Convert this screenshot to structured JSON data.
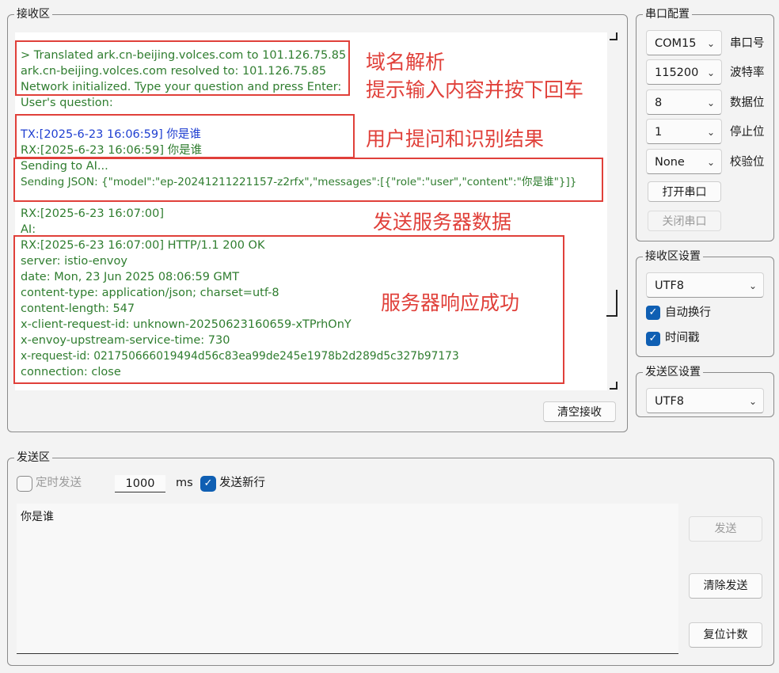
{
  "receive": {
    "title": "接收区",
    "lines": [
      "> Translated ark.cn-beijing.volces.com to 101.126.75.85",
      "ark.cn-beijing.volces.com resolved to: 101.126.75.85",
      "Network initialized. Type your question and press Enter:",
      "User's question:",
      "TX:[2025-6-23 16:06:59] 你是谁",
      "RX:[2025-6-23 16:06:59] 你是谁",
      "Sending to AI...",
      "Sending JSON: {\"model\":\"ep-20241211221157-z2rfx\",\"messages\":[{\"role\":\"user\",\"content\":\"你是谁\"}]}",
      "RX:[2025-6-23 16:07:00]",
      "AI:",
      "RX:[2025-6-23 16:07:00] HTTP/1.1 200 OK",
      "server: istio-envoy",
      "date: Mon, 23 Jun 2025 08:06:59 GMT",
      "content-type: application/json; charset=utf-8",
      "content-length: 547",
      "x-client-request-id: unknown-20250623160659-xTPrhOnY",
      "x-envoy-upstream-service-time: 730",
      "x-request-id: 021750666019494d56c83ea99de245e1978b2d289d5c327b97173",
      "connection: close"
    ],
    "annotations": [
      "域名解析",
      "提示输入内容并按下回车",
      "用户提问和识别结果",
      "发送服务器数据",
      "服务器响应成功"
    ],
    "clear_button": "清空接收"
  },
  "serial": {
    "title": "串口配置",
    "port": {
      "value": "COM15",
      "label": "串口号"
    },
    "baud": {
      "value": "115200",
      "label": "波特率"
    },
    "data_bits": {
      "value": "8",
      "label": "数据位"
    },
    "stop_bits": {
      "value": "1",
      "label": "停止位"
    },
    "parity": {
      "value": "None",
      "label": "校验位"
    },
    "open_button": "打开串口",
    "close_button": "关闭串口"
  },
  "recv_settings": {
    "title": "接收区设置",
    "encoding": "UTF8",
    "auto_wrap": {
      "label": "自动换行",
      "checked": true
    },
    "timestamp": {
      "label": "时间戳",
      "checked": true
    }
  },
  "send_settings": {
    "title": "发送区设置",
    "encoding": "UTF8"
  },
  "send": {
    "title": "发送区",
    "timed_send_label": "定时发送",
    "interval": "1000",
    "unit": "ms",
    "newline_label": "发送新行",
    "text": "你是谁",
    "send_button": "发送",
    "clear_button": "清除发送",
    "reset_button": "复位计数"
  },
  "colors": {
    "rx_text": "#2f7d2f",
    "tx_text": "#1f3fd1",
    "annotation": "#e0403a",
    "checkbox": "#0f5fb3"
  }
}
